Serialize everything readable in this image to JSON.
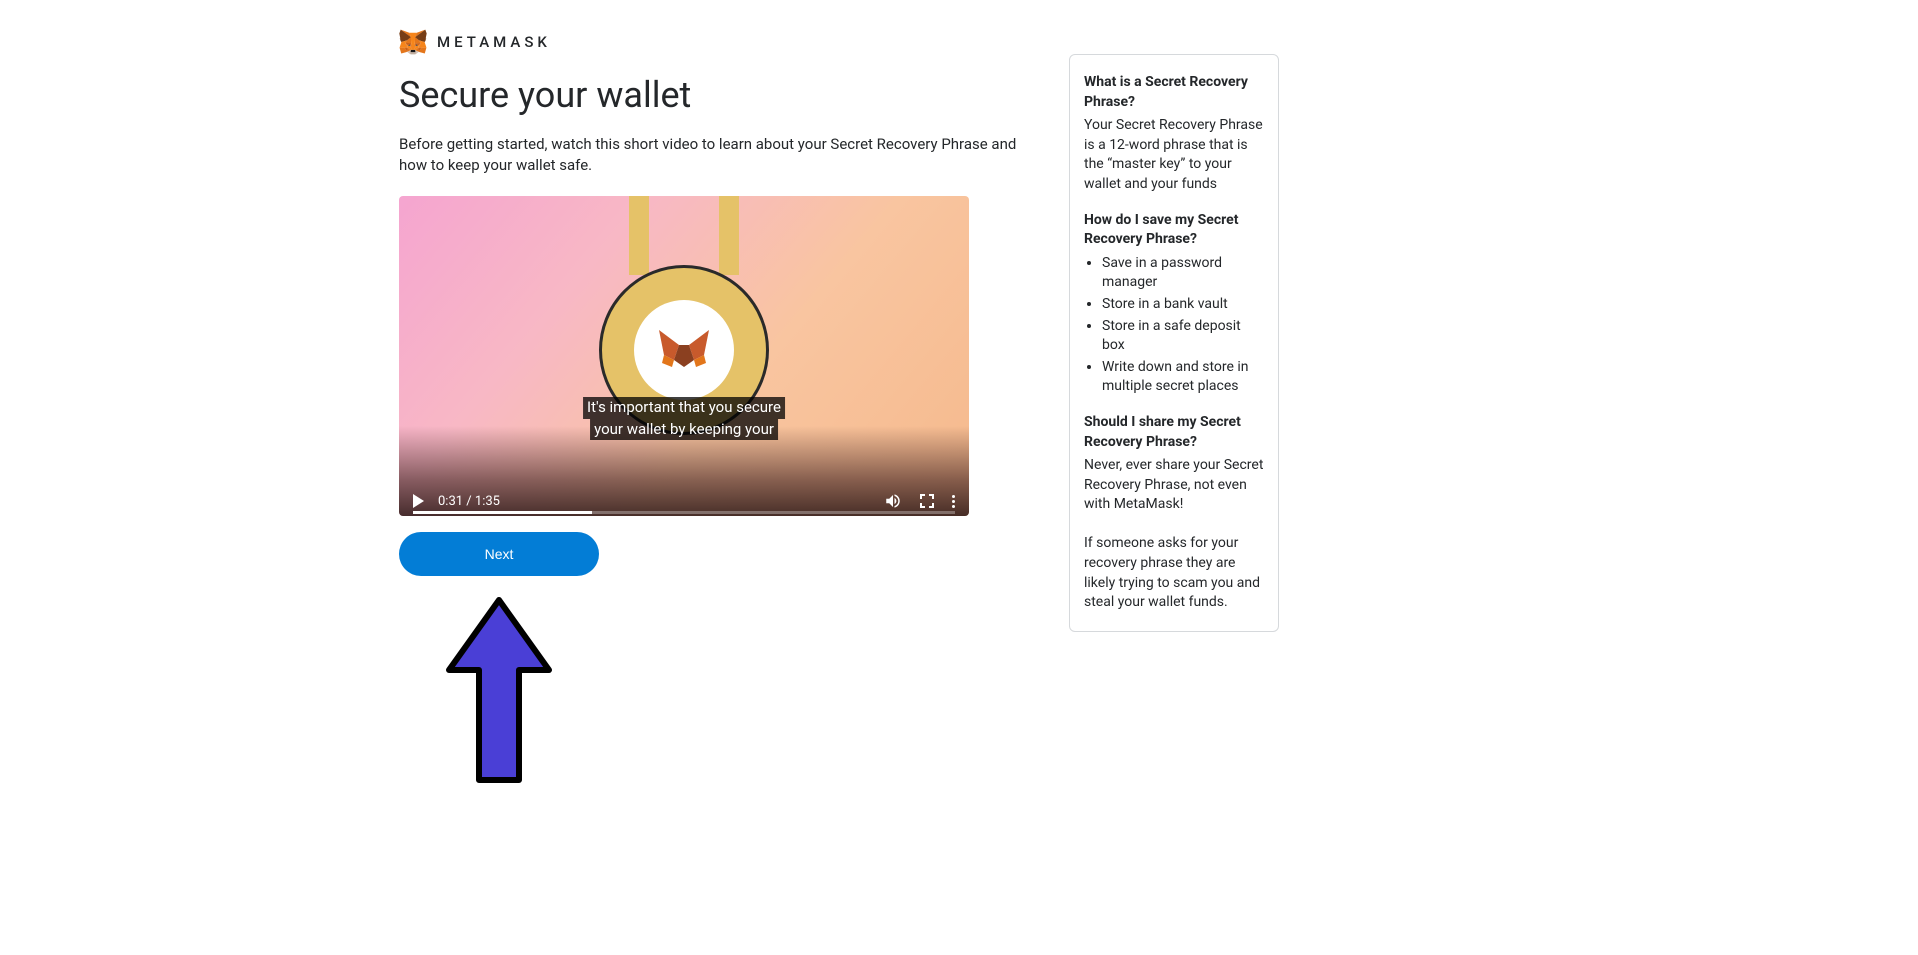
{
  "brand": {
    "name": "METAMASK"
  },
  "page": {
    "title": "Secure your wallet",
    "intro": "Before getting started, watch this short video to learn about your Secret Recovery Phrase and how to keep your wallet safe."
  },
  "video": {
    "caption_line1": "It's important that you secure",
    "caption_line2": "your wallet by keeping your",
    "current_time": "0:31",
    "duration": "1:35",
    "progress_percent": 33
  },
  "buttons": {
    "next": "Next"
  },
  "sidebar": {
    "section1": {
      "heading": "What is a Secret Recovery Phrase?",
      "text": "Your Secret Recovery Phrase is a 12-word phrase that is the “master key” to your wallet and your funds"
    },
    "section2": {
      "heading": "How do I save my Secret Recovery Phrase?",
      "items": [
        "Save in a password manager",
        "Store in a bank vault",
        "Store in a safe deposit box",
        "Write down and store in multiple secret places"
      ]
    },
    "section3": {
      "heading": "Should I share my Secret Recovery Phrase?",
      "text1": "Never, ever share your Secret Recovery Phrase, not even with MetaMask!",
      "text2": "If someone asks for your recovery phrase they are likely trying to scam you and steal your wallet funds."
    }
  }
}
